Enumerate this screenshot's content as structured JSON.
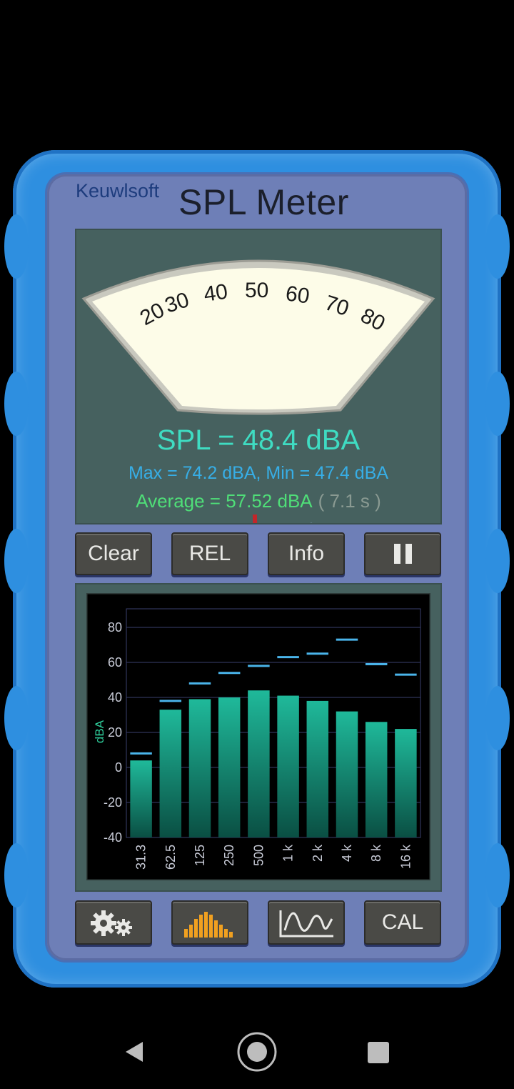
{
  "app": {
    "brand": "Keuwlsoft",
    "title": "SPL Meter"
  },
  "meter": {
    "scale_labels": [
      "20",
      "30",
      "40",
      "50",
      "60",
      "70",
      "80"
    ],
    "needle_value_dba": 48.4,
    "max_hold_value_dba": 74.2,
    "spl_text": "SPL = 48.4 dBA",
    "maxmin_text": "Max = 74.2 dBA,  Min = 47.4 dBA",
    "average_text": "Average = 57.52 dBA",
    "duration_text": "( 7.1 s )"
  },
  "buttons": {
    "clear": "Clear",
    "rel": "REL",
    "info": "Info",
    "pause_icon": "pause-icon",
    "settings_icon": "gears-icon",
    "spectrum_icon": "bar-spectrum-icon",
    "graph_icon": "line-graph-icon",
    "cal": "CAL"
  },
  "chart_data": {
    "type": "bar",
    "ylabel": "dBA",
    "xlabel": "",
    "ylim": [
      -40,
      80
    ],
    "yticks": [
      80,
      60,
      40,
      20,
      0,
      -20,
      -40
    ],
    "categories": [
      "31.3",
      "62.5",
      "125",
      "250",
      "500",
      "1 k",
      "2 k",
      "4 k",
      "8 k",
      "16 k"
    ],
    "series": [
      {
        "values": [
          4,
          33,
          39,
          40,
          44,
          41,
          38,
          32,
          26,
          22
        ]
      },
      {
        "values": [
          8,
          38,
          48,
          54,
          58,
          63,
          65,
          73,
          59,
          53
        ]
      }
    ],
    "colors": {
      "bar_top": "#1fb99a",
      "bar_bottom": "#0a4f43",
      "peak": "#4ab4ea",
      "grid": "#3a3f6e"
    },
    "grid": true
  },
  "nav": {
    "back_icon": "back-icon",
    "home_icon": "home-icon",
    "recents_icon": "recents-icon"
  }
}
